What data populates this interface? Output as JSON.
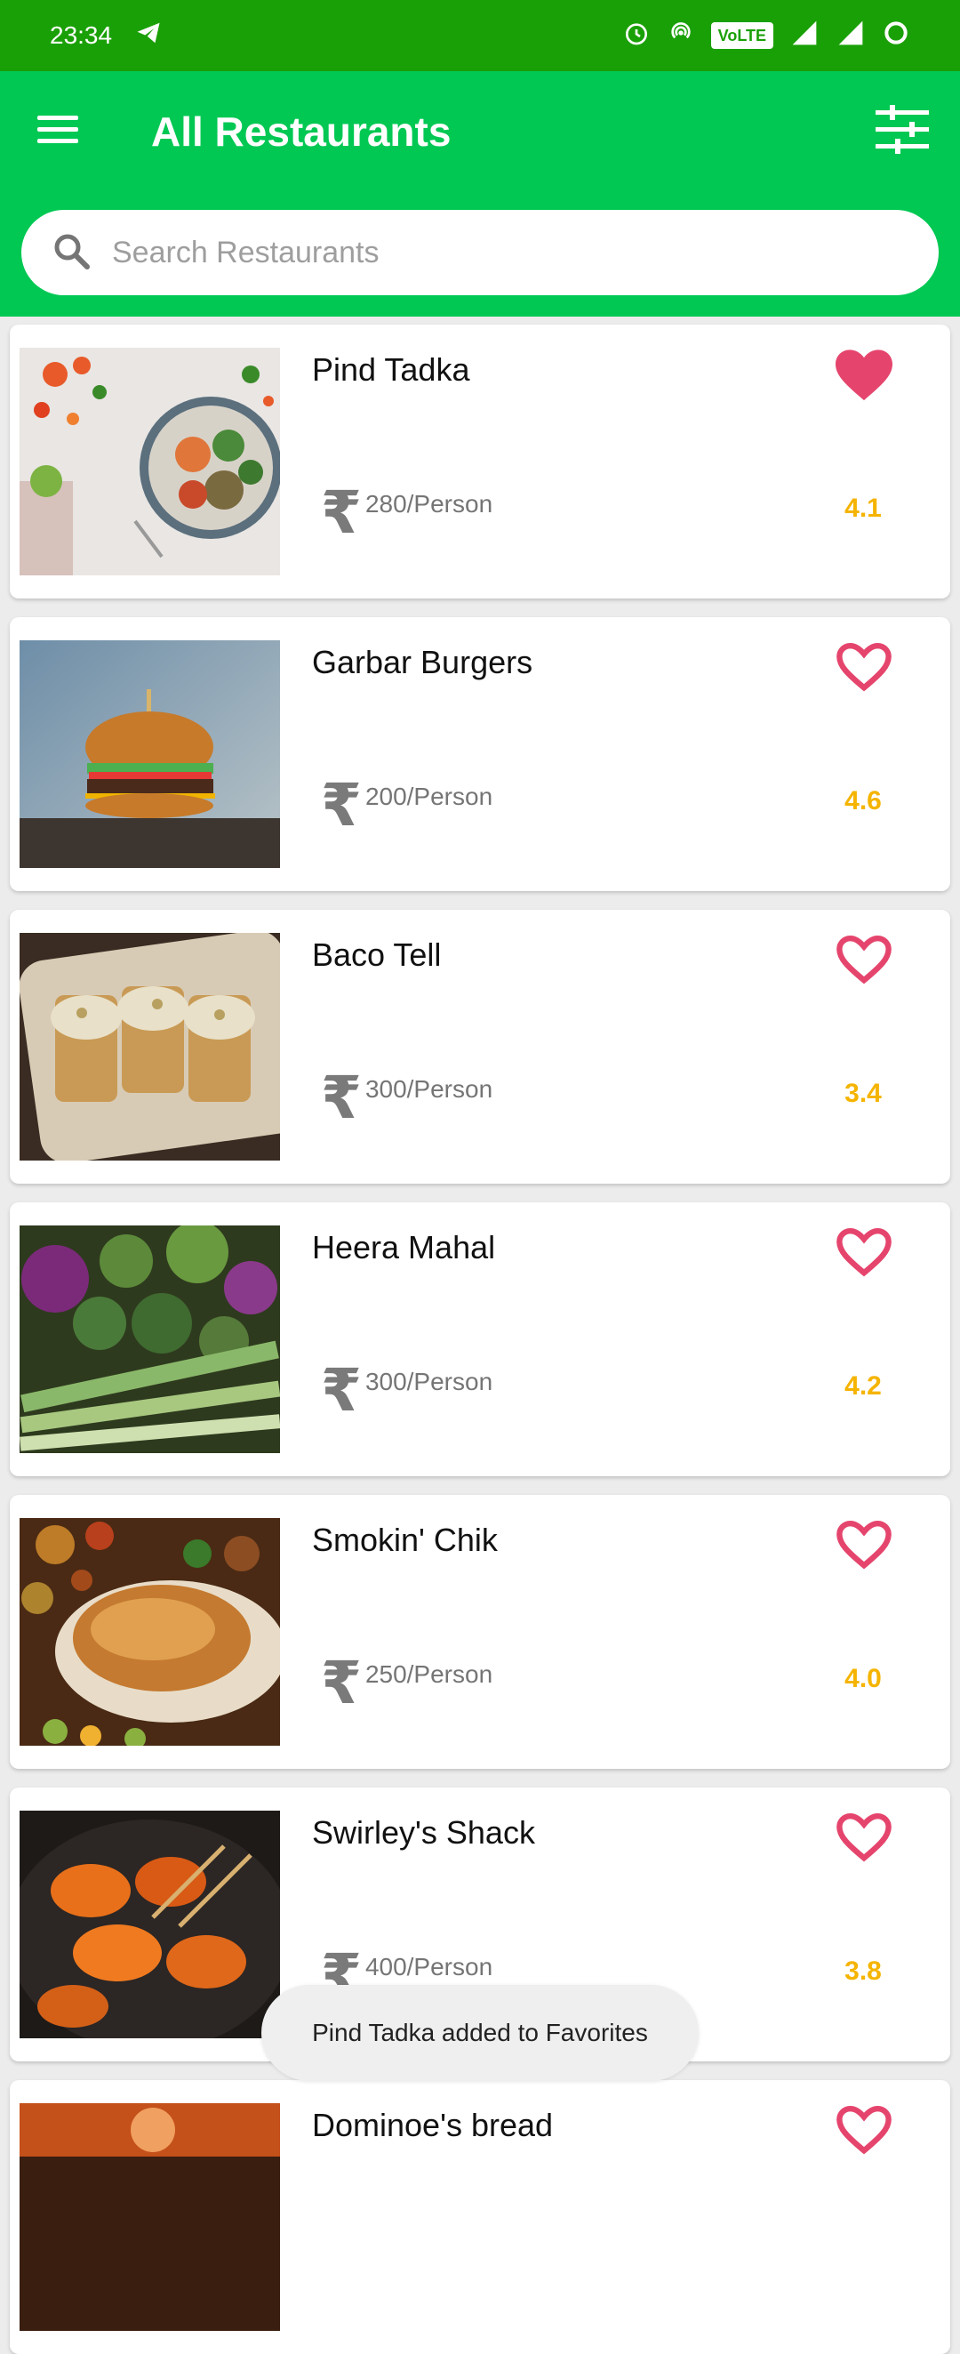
{
  "status_bar": {
    "time": "23:34",
    "volte": "VoLTE",
    "network": "4G"
  },
  "app_bar": {
    "title": "All Restaurants",
    "icons": [
      "menu-icon",
      "filter-icon"
    ],
    "color": "#00c853"
  },
  "search": {
    "placeholder": "Search Restaurants",
    "value": ""
  },
  "restaurants": [
    {
      "name": "Pind Tadka",
      "price": "280/Person",
      "rating": "4.1",
      "favorite": true
    },
    {
      "name": "Garbar Burgers",
      "price": "200/Person",
      "rating": "4.6",
      "favorite": false
    },
    {
      "name": "Baco Tell",
      "price": "300/Person",
      "rating": "3.4",
      "favorite": false
    },
    {
      "name": "Heera Mahal",
      "price": "300/Person",
      "rating": "4.2",
      "favorite": false
    },
    {
      "name": "Smokin' Chik",
      "price": "250/Person",
      "rating": "4.0",
      "favorite": false
    },
    {
      "name": "Swirley's Shack",
      "price": "400/Person",
      "rating": "3.8",
      "favorite": false
    },
    {
      "name": "Dominoe's bread",
      "price": "",
      "rating": "",
      "favorite": false
    }
  ],
  "currency_symbol": "₹",
  "toast": "Pind Tadka added to Favorites",
  "colors": {
    "status_bar": "#1aa007",
    "heart": "#e5456d",
    "rating": "#f5b400"
  }
}
